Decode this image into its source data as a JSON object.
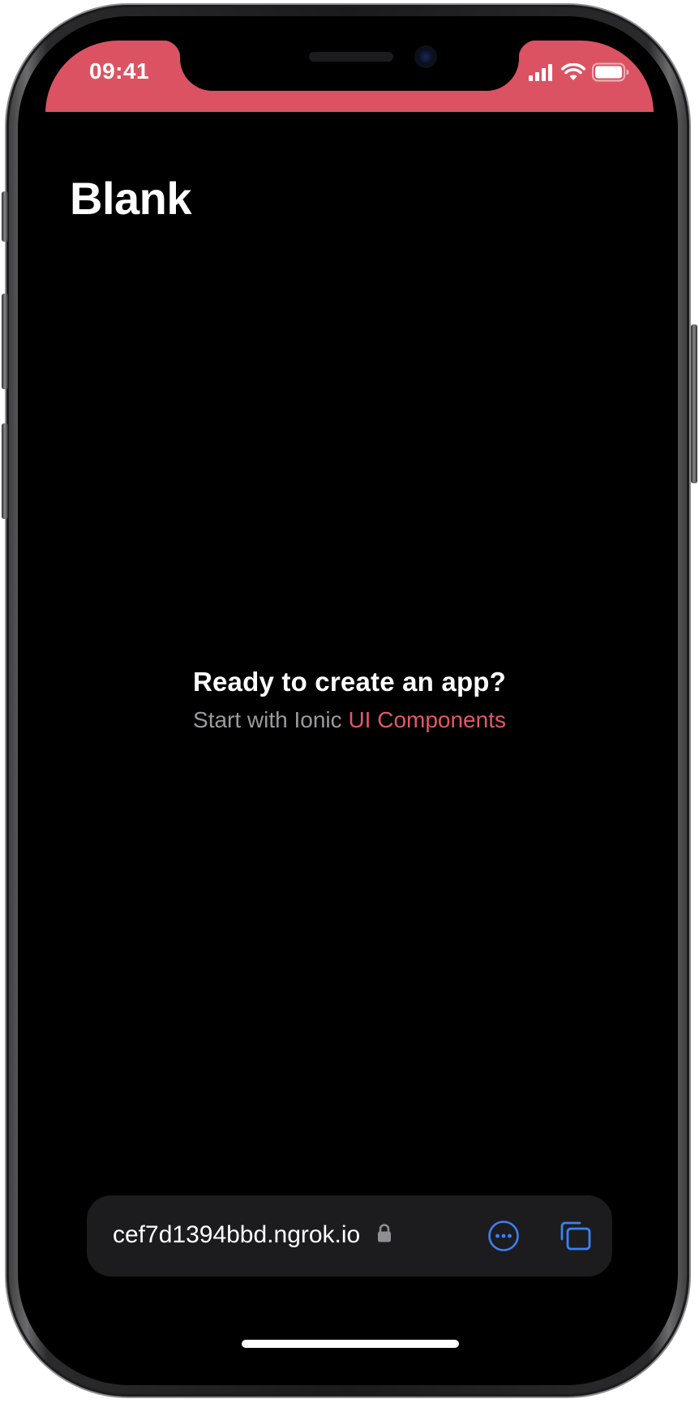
{
  "statusbar": {
    "time": "09:41",
    "background": "#db5362",
    "signal_icon": "cellular-signal-icon",
    "wifi_icon": "wifi-icon",
    "battery_icon": "battery-icon"
  },
  "header": {
    "title": "Blank"
  },
  "main": {
    "heading": "Ready to create an app?",
    "subtext_prefix": "Start with Ionic",
    "link_label": "UI Components",
    "link_color": "#e25866"
  },
  "browser_bar": {
    "url": "cef7d1394bbd.ngrok.io",
    "lock_icon": "lock-icon",
    "more_icon": "ellipsis-circle-icon",
    "tabs_icon": "tabs-icon",
    "accent_color": "#3a82f7"
  }
}
